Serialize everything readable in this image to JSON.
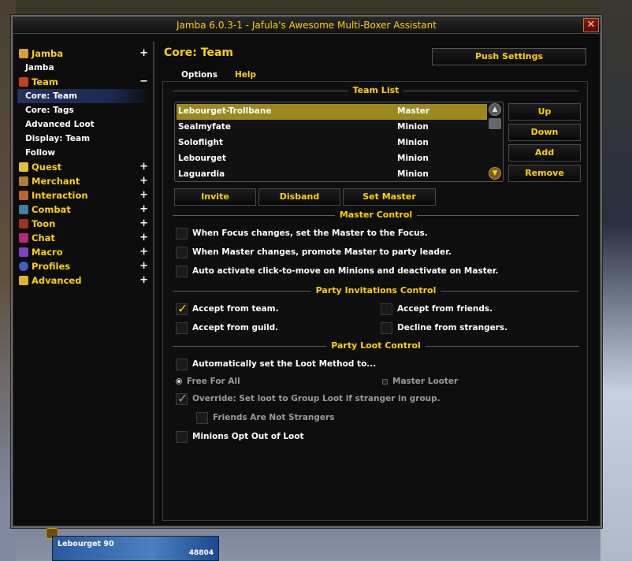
{
  "window": {
    "title": "Jamba 6.0.3-1 - Jafula's Awesome Multi-Boxer Assistant",
    "close_symbol": "✕"
  },
  "sidebar": {
    "groups": [
      {
        "label": "Jamba",
        "icon": "jamba-icon",
        "icon_color": "#d8a030",
        "toggle": "+"
      },
      {
        "label": "Team",
        "icon": "team-icon",
        "icon_color": "#c04020",
        "toggle": "−",
        "items": [
          "Core: Team",
          "Core: Tags",
          "Advanced Loot",
          "Display: Team",
          "Follow"
        ]
      },
      {
        "label": "Quest",
        "icon": "quest-icon",
        "icon_color": "#e0c040",
        "toggle": "+"
      },
      {
        "label": "Merchant",
        "icon": "merchant-icon",
        "icon_color": "#b08030",
        "toggle": "+"
      },
      {
        "label": "Interaction",
        "icon": "interaction-icon",
        "icon_color": "#c06030",
        "toggle": "+"
      },
      {
        "label": "Combat",
        "icon": "combat-icon",
        "icon_color": "#4080a0",
        "toggle": "+"
      },
      {
        "label": "Toon",
        "icon": "toon-icon",
        "icon_color": "#a03020",
        "toggle": "+"
      },
      {
        "label": "Chat",
        "icon": "chat-icon",
        "icon_color": "#c02080",
        "toggle": "+"
      },
      {
        "label": "Macro",
        "icon": "macro-icon",
        "icon_color": "#8040c0",
        "toggle": "+"
      },
      {
        "label": "Profiles",
        "icon": "profiles-icon",
        "icon_color": "#4060c0",
        "toggle": "+"
      },
      {
        "label": "Advanced",
        "icon": "advanced-icon",
        "icon_color": "#e0b030",
        "toggle": "+"
      }
    ],
    "jamba_sub": "Jamba",
    "selected": "Core: Team"
  },
  "content": {
    "title": "Core: Team",
    "push_settings": "Push Settings",
    "tabs": {
      "options": "Options",
      "help": "Help"
    },
    "team_list": {
      "heading": "Team List",
      "rows": [
        {
          "name": "Lebourget-Trollbane",
          "role": "Master"
        },
        {
          "name": "Sealmyfate",
          "role": "Minion"
        },
        {
          "name": "Soloflight",
          "role": "Minion"
        },
        {
          "name": "Lebourget",
          "role": "Minion"
        },
        {
          "name": "Laguardia",
          "role": "Minion"
        }
      ],
      "buttons": {
        "up": "Up",
        "down": "Down",
        "add": "Add",
        "remove": "Remove"
      }
    },
    "actions": {
      "invite": "Invite",
      "disband": "Disband",
      "set_master": "Set Master"
    },
    "master_control": {
      "heading": "Master Control",
      "opt1": "When Focus changes, set the Master to the Focus.",
      "opt2": "When Master changes, promote Master to party leader.",
      "opt3": "Auto activate click-to-move on Minions and deactivate on Master."
    },
    "party_invitations": {
      "heading": "Party Invitations Control",
      "from_team": "Accept from team.",
      "from_friends": "Accept from friends.",
      "from_guild": "Accept from guild.",
      "decline_strangers": "Decline from strangers."
    },
    "party_loot": {
      "heading": "Party Loot Control",
      "auto_loot": "Automatically set the Loot Method to...",
      "free_for_all": "Free For All",
      "master_looter": "Master Looter",
      "override": "Override: Set loot to Group Loot if stranger in group.",
      "friends_not_strangers": "Friends Are Not Strangers",
      "minions_opt_out": "Minions Opt Out of Loot"
    }
  },
  "unit_frame": {
    "name": "Lebourget 90",
    "hp": "48804"
  }
}
